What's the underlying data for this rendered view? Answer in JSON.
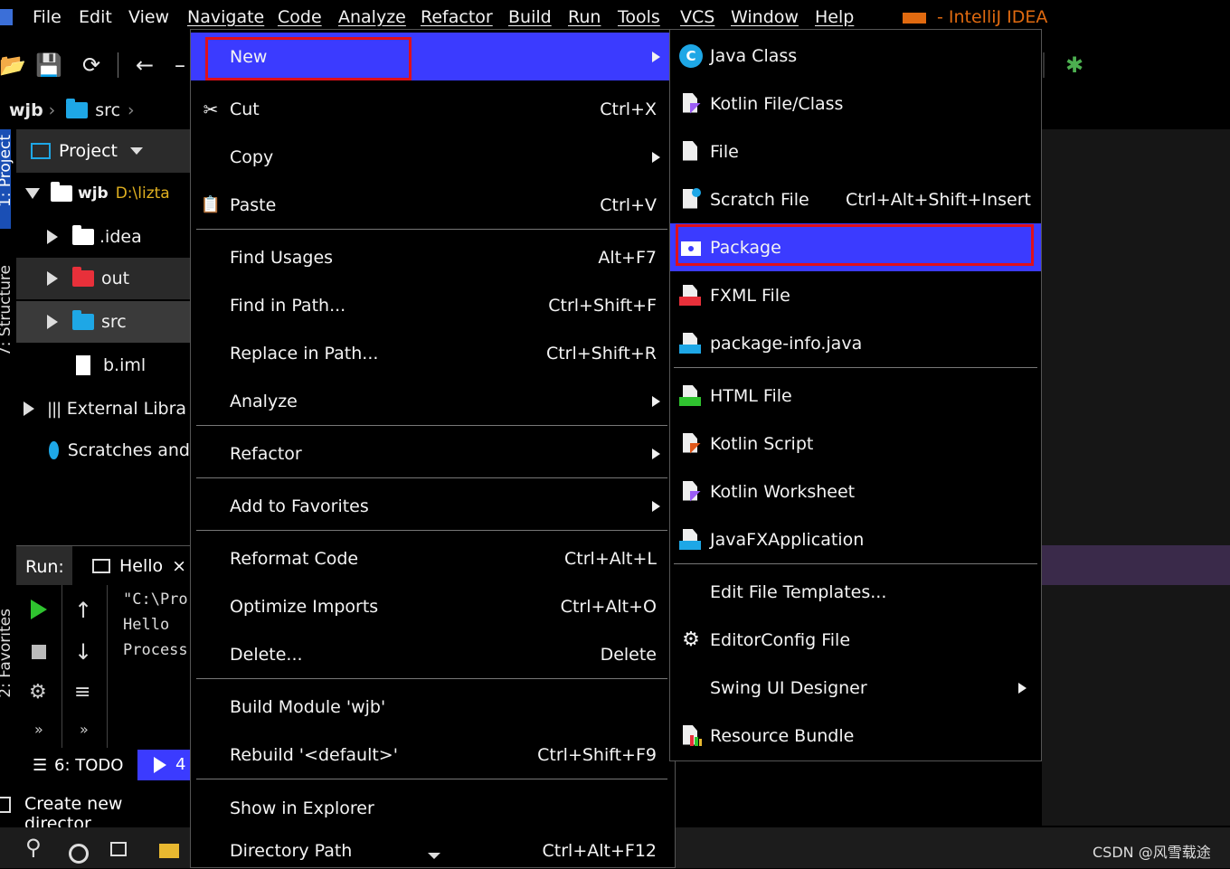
{
  "menubar": {
    "items": [
      "File",
      "Edit",
      "View",
      "Navigate",
      "Code",
      "Analyze",
      "Refactor",
      "Build",
      "Run",
      "Tools",
      "VCS",
      "Window",
      "Help"
    ],
    "app_title": "- IntelliJ IDEA"
  },
  "breadcrumb": {
    "project": "wjb",
    "folder": "src"
  },
  "left_strip": {
    "project_tab": "1: Project",
    "structure_tab": "7: Structure",
    "favorites_tab": "2: Favorites"
  },
  "project_panel": {
    "header": "Project",
    "tree": [
      {
        "label": "wjb",
        "path": "D:\\lizta",
        "expanded": true
      },
      {
        "label": ".idea"
      },
      {
        "label": "out"
      },
      {
        "label": "src"
      },
      {
        "label": "b.iml"
      },
      {
        "label": "External Libra"
      },
      {
        "label": "Scratches and"
      }
    ]
  },
  "run_panel": {
    "label": "Run:",
    "tab": "Hello",
    "console": [
      "\"C:\\Pro",
      "Hello",
      "Process"
    ]
  },
  "bottom_bar": {
    "todo": "6: TODO",
    "run_tab": "4"
  },
  "status": {
    "message": "Create new director"
  },
  "context_menu": {
    "items": [
      {
        "label": "New",
        "shortcut": "",
        "submenu": true,
        "highlight": true
      },
      {
        "label": "Cut",
        "shortcut": "Ctrl+X"
      },
      {
        "label": "Copy",
        "shortcut": "",
        "submenu": true
      },
      {
        "label": "Paste",
        "shortcut": "Ctrl+V"
      },
      {
        "label": "Find Usages",
        "shortcut": "Alt+F7"
      },
      {
        "label": "Find in Path...",
        "shortcut": "Ctrl+Shift+F"
      },
      {
        "label": "Replace in Path...",
        "shortcut": "Ctrl+Shift+R"
      },
      {
        "label": "Analyze",
        "shortcut": "",
        "submenu": true
      },
      {
        "label": "Refactor",
        "shortcut": "",
        "submenu": true
      },
      {
        "label": "Add to Favorites",
        "shortcut": "",
        "submenu": true
      },
      {
        "label": "Reformat Code",
        "shortcut": "Ctrl+Alt+L"
      },
      {
        "label": "Optimize Imports",
        "shortcut": "Ctrl+Alt+O"
      },
      {
        "label": "Delete...",
        "shortcut": "Delete"
      },
      {
        "label": "Build Module 'wjb'",
        "shortcut": ""
      },
      {
        "label": "Rebuild '<default>'",
        "shortcut": "Ctrl+Shift+F9"
      },
      {
        "label": "Show in Explorer",
        "shortcut": ""
      },
      {
        "label": "Directory Path",
        "shortcut": "Ctrl+Alt+F12"
      }
    ]
  },
  "new_submenu": {
    "items": [
      {
        "label": "Java Class",
        "icon": "java-class-icon"
      },
      {
        "label": "Kotlin File/Class",
        "icon": "kotlin-file-icon"
      },
      {
        "label": "File",
        "icon": "file-icon"
      },
      {
        "label": "Scratch File",
        "shortcut": "Ctrl+Alt+Shift+Insert",
        "icon": "scratch-file-icon"
      },
      {
        "label": "Package",
        "icon": "package-icon",
        "highlight": true
      },
      {
        "label": "FXML File",
        "icon": "fxml-file-icon"
      },
      {
        "label": "package-info.java",
        "icon": "package-info-icon"
      },
      {
        "label": "HTML File",
        "icon": "html-file-icon"
      },
      {
        "label": "Kotlin Script",
        "icon": "kotlin-script-icon"
      },
      {
        "label": "Kotlin Worksheet",
        "icon": "kotlin-worksheet-icon"
      },
      {
        "label": "JavaFXApplication",
        "icon": "javafx-app-icon"
      },
      {
        "label": "Edit File Templates...",
        "icon": ""
      },
      {
        "label": "EditorConfig File",
        "icon": "gear-icon"
      },
      {
        "label": "Swing UI Designer",
        "icon": "",
        "submenu": true
      },
      {
        "label": "Resource Bundle",
        "icon": "resource-bundle-icon"
      }
    ]
  },
  "watermark": "CSDN @风雪载途",
  "colors": {
    "highlight": "#3b3bff",
    "annotation": "#e0101a",
    "title": "#e06a10"
  }
}
